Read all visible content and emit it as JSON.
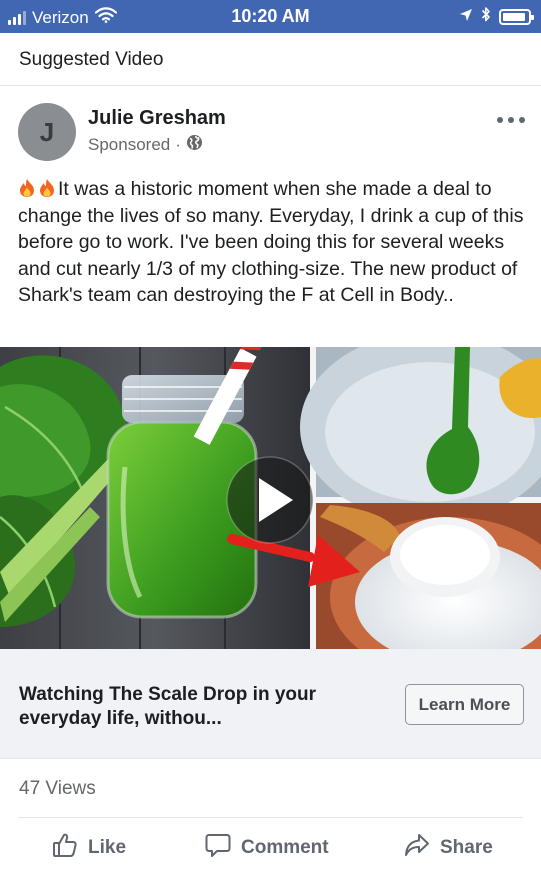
{
  "status_bar": {
    "carrier": "Verizon",
    "time": "10:20 AM",
    "battery_level": 0.9
  },
  "section": {
    "title": "Suggested Video"
  },
  "post": {
    "avatar_initial": "J",
    "author": "Julie Gresham",
    "sponsored": "Sponsored",
    "separator": "·",
    "text": "It was a historic moment when she made a deal to change the lives of so many. Everyday, I drink a cup of this before go to work. I've been doing this for several weeks and cut nearly 1/3 of my clothing-size. The new product of Shark's team can destroying the F at Cell in Body.."
  },
  "link_card": {
    "title": "Watching The Scale Drop in your everyday life, withou...",
    "cta_label": "Learn More"
  },
  "stats": {
    "views": "47 Views"
  },
  "actions": {
    "like_label": "Like",
    "comment_label": "Comment",
    "share_label": "Share"
  },
  "icons": {
    "signal": "signal-icon",
    "wifi": "wifi-icon",
    "location": "location-arrow-icon",
    "bluetooth": "bluetooth-icon",
    "battery": "battery-icon",
    "globe": "globe-icon",
    "more": "more-options-icon",
    "play": "play-icon",
    "like": "thumbs-up-icon",
    "comment": "comment-bubble-icon",
    "share": "share-arrow-icon"
  },
  "colors": {
    "status_bar": "#4267b2",
    "card_background": "#f0f2f5",
    "secondary_text": "#65676b"
  }
}
